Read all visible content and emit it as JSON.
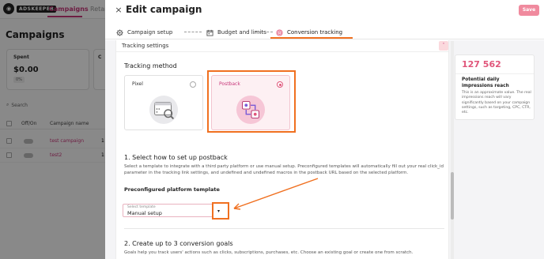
{
  "background_app": {
    "logo_text": "ADSKEEPER",
    "nav": [
      "Campaigns",
      "Retarg"
    ],
    "page_title": "Campaigns",
    "stat_card": {
      "label": "Spent",
      "value": "$0.00",
      "chip": "0%"
    },
    "stat_card2_label": "C",
    "search_placeholder": "Search",
    "table_headers": [
      "Off/On",
      "Campaign name"
    ],
    "rows": [
      {
        "name": "test campaign",
        "extra": "1"
      },
      {
        "name": "test2",
        "extra": "1"
      }
    ]
  },
  "modal": {
    "close_label": "×",
    "title": "Edit campaign",
    "save_label": "Save",
    "tabs": [
      {
        "label": "Campaign setup",
        "icon": "gear-icon"
      },
      {
        "label": "Budget and limits",
        "icon": "calendar-icon"
      },
      {
        "label": "Conversion tracking",
        "icon": "target-icon",
        "active": true
      }
    ],
    "section_label": "Tracking settings",
    "collapse_label": "˄",
    "tracking_method": {
      "title": "Tracking method",
      "options": [
        {
          "label": "Pixel",
          "selected": false
        },
        {
          "label": "Postback",
          "selected": true
        }
      ]
    },
    "step1": {
      "title": "1. Select how to set up postback",
      "description": "Select a template to integrate with a third party platform or use manual setup. Preconfigured templates will automatically fill out your real click_id parameter in the tracking link settings, and undefined and undefined macros in the postback URL based on the selected platform.",
      "template_label": "Preconfigured platform template",
      "select_small_label": "Select template",
      "select_value": "Manual setup",
      "dropdown_arrow": "▾"
    },
    "step2": {
      "title": "2. Create up to 3 conversion goals",
      "description": "Goals help you track users' actions such as clicks, subscriptions, purchases, etc. Choose an existing goal or create one from scratch."
    },
    "side_panel": {
      "value": "127 562",
      "title": "Potential daily impressions reach",
      "description": "This is an approximate value. The real impressions reach will vary significantly based on your campaign settings, such as targeting, CPC, CTR, etc."
    }
  },
  "colors": {
    "accent": "#c8377a",
    "annotation": "#f07020",
    "save": "#f08a9e"
  }
}
